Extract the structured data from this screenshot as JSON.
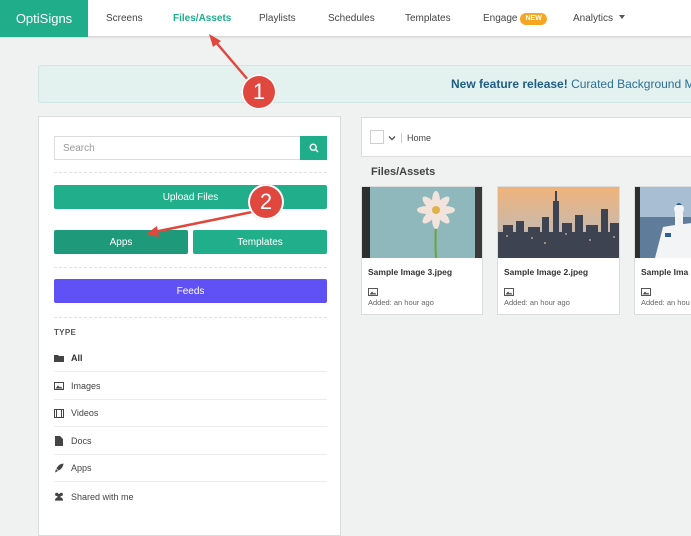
{
  "nav": {
    "logo": "OptiSigns",
    "items": [
      {
        "label": "Screens"
      },
      {
        "label": "Files/Assets"
      },
      {
        "label": "Playlists"
      },
      {
        "label": "Schedules"
      },
      {
        "label": "Templates"
      },
      {
        "label": "Engage",
        "badge": "NEW"
      },
      {
        "label": "Analytics"
      }
    ]
  },
  "banner": {
    "title": "New feature release!",
    "text": "Curated Background Music"
  },
  "left": {
    "search_placeholder": "Search",
    "upload_label": "Upload Files",
    "apps_label": "Apps",
    "templates_label": "Templates",
    "feeds_label": "Feeds",
    "type_heading": "TYPE",
    "types": [
      {
        "label": "All",
        "icon": "folder-icon"
      },
      {
        "label": "Images",
        "icon": "image-icon"
      },
      {
        "label": "Videos",
        "icon": "film-icon"
      },
      {
        "label": "Docs",
        "icon": "document-icon"
      },
      {
        "label": "Apps",
        "icon": "rocket-icon"
      },
      {
        "label": "Shared with me",
        "icon": "users-icon"
      }
    ]
  },
  "right": {
    "breadcrumb": "Home",
    "section_title": "Files/Assets",
    "cards": [
      {
        "name": "Sample Image 3.jpeg",
        "added": "Added: an hour ago",
        "thumb": "flower"
      },
      {
        "name": "Sample Image 2.jpeg",
        "added": "Added: an hour ago",
        "thumb": "city"
      },
      {
        "name": "Sample Ima",
        "added": "Added: an hou",
        "thumb": "coast"
      }
    ]
  },
  "annotations": {
    "step1": "1",
    "step2": "2"
  },
  "colors": {
    "brand": "#1fad8a",
    "feeds": "#6051f7",
    "annotation": "#e0473f",
    "badge": "#f5a623"
  }
}
